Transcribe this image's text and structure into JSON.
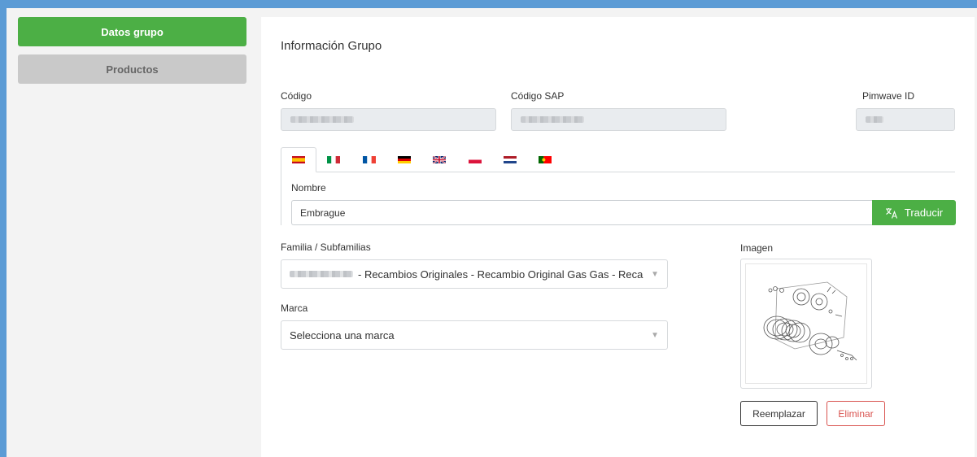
{
  "sidebar": {
    "items": [
      {
        "label": "Datos grupo",
        "active": true
      },
      {
        "label": "Productos",
        "active": false
      }
    ]
  },
  "card": {
    "title": "Información Grupo",
    "fields": {
      "codigo_label": "Código",
      "codigo_sap_label": "Código SAP",
      "pimwave_label": "Pimwave ID"
    },
    "language_tabs": [
      {
        "lang": "es",
        "icon": "spain-flag-icon"
      },
      {
        "lang": "it",
        "icon": "italy-flag-icon"
      },
      {
        "lang": "fr",
        "icon": "france-flag-icon"
      },
      {
        "lang": "de",
        "icon": "germany-flag-icon"
      },
      {
        "lang": "en",
        "icon": "uk-flag-icon"
      },
      {
        "lang": "pl",
        "icon": "poland-flag-icon"
      },
      {
        "lang": "nl",
        "icon": "netherlands-flag-icon"
      },
      {
        "lang": "pt",
        "icon": "portugal-flag-icon"
      }
    ],
    "nombre_label": "Nombre",
    "nombre_value": "Embrague",
    "translate_label": "Traducir",
    "familia_label": "Familia / Subfamilias",
    "familia_value": "- Recambios Originales - Recambio Original Gas Gas - Reca…",
    "marca_label": "Marca",
    "marca_placeholder": "Selecciona una marca",
    "imagen_label": "Imagen",
    "replace_label": "Reemplazar",
    "delete_label": "Eliminar"
  },
  "colors": {
    "accent_green": "#4caf45",
    "danger_red": "#d9534f",
    "frame_blue": "#5b9bd5"
  }
}
